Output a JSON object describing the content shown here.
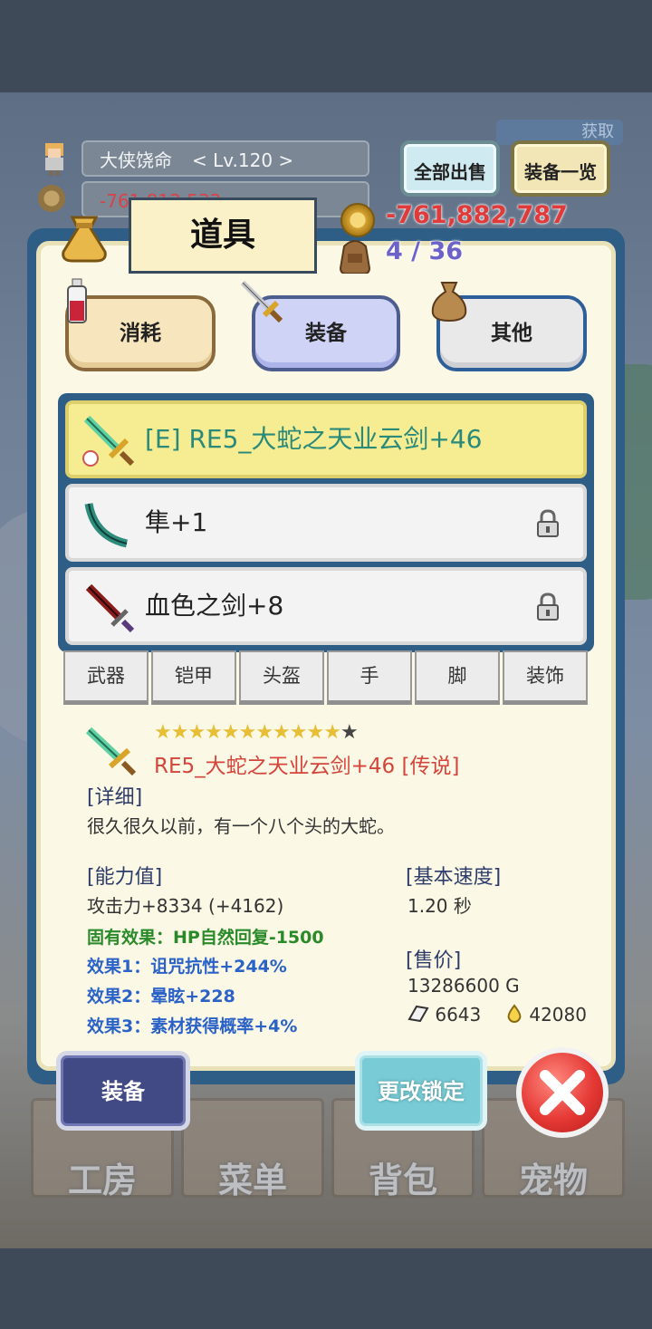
{
  "player": {
    "name": "大侠饶命",
    "level": "< Lv.120 >",
    "gold_faded": "-761,812,532"
  },
  "top_buttons": {
    "sell_all": "全部出售",
    "equip_list": "装备一览",
    "gift_tag": "获取"
  },
  "resources": {
    "gold": "-761,882,787",
    "bag": "4 / 36"
  },
  "panel": {
    "title": "道具",
    "categories": [
      {
        "label": "消耗"
      },
      {
        "label": "装备"
      },
      {
        "label": "其他"
      }
    ],
    "items": [
      {
        "label": "[E] RE5_大蛇之天业云剑+46",
        "selected": true,
        "locked": false
      },
      {
        "label": "隼+1",
        "selected": false,
        "locked": true
      },
      {
        "label": "血色之剑+8",
        "selected": false,
        "locked": true
      }
    ],
    "slots": [
      "武器",
      "铠甲",
      "头盔",
      "手",
      "脚",
      "装饰"
    ]
  },
  "detail": {
    "stars_filled": "★★★★★★★★★★★",
    "stars_empty": "★",
    "name": "RE5_大蛇之天业云剑+46 [传说]",
    "detail_header": "[详细]",
    "description": "很久很久以前，有一个八个头的大蛇。",
    "ability_header": "[能力值]",
    "attack": "攻击力+8334 (+4162)",
    "intrinsic": "固有效果：HP自然回复-1500",
    "effect1": "效果1：诅咒抗性+244%",
    "effect2": "效果2：晕眩+228",
    "effect3": "效果3：素材获得概率+4%",
    "speed_header": "[基本速度]",
    "speed": "1.20 秒",
    "price_header": "[售价]",
    "price": "13286600 G",
    "stone": "6643",
    "essence": "42080"
  },
  "actions": {
    "equip": "装备",
    "change_lock": "更改锁定"
  },
  "nav": [
    "工房",
    "菜单",
    "背包",
    "宠物"
  ],
  "colors": {
    "panel_blue": "#2e5d86",
    "panel_cream": "#fbf8e5",
    "gold_red": "#e03a3a",
    "selected_row": "#f6ec91"
  }
}
